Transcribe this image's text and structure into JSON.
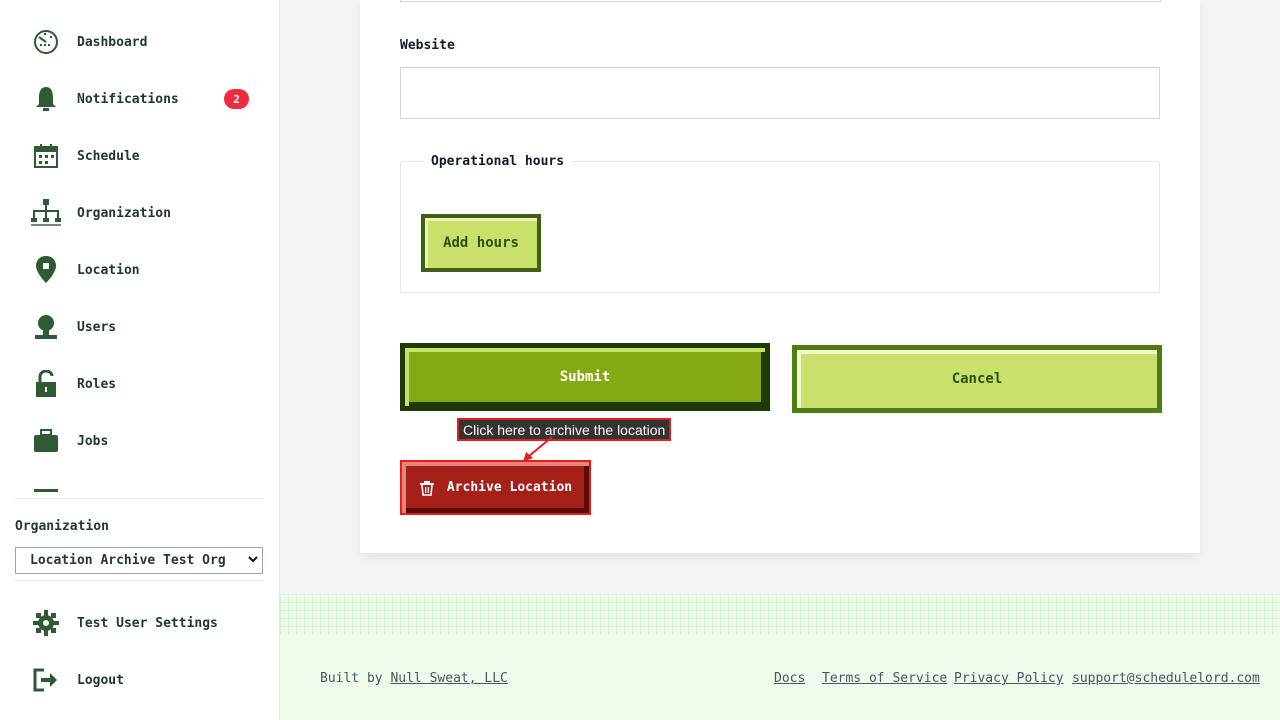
{
  "sidebar": {
    "items": [
      {
        "label": "Dashboard",
        "icon": "dashboard-icon"
      },
      {
        "label": "Notifications",
        "icon": "bell-icon",
        "badge": "2"
      },
      {
        "label": "Schedule",
        "icon": "calendar-icon"
      },
      {
        "label": "Organization",
        "icon": "org-chart-icon"
      },
      {
        "label": "Location",
        "icon": "location-pin-icon"
      },
      {
        "label": "Users",
        "icon": "user-icon"
      },
      {
        "label": "Roles",
        "icon": "lock-icon"
      },
      {
        "label": "Jobs",
        "icon": "briefcase-icon"
      }
    ],
    "organization_label": "Organization",
    "organization_selected": "Location Archive Test Org",
    "settings_label": "Test User Settings",
    "logout_label": "Logout"
  },
  "form": {
    "website_label": "Website",
    "website_value": "",
    "hours_legend": "Operational hours",
    "add_hours_label": "Add hours",
    "submit_label": "Submit",
    "cancel_label": "Cancel",
    "archive_label": "Archive Location",
    "tooltip": "Click here to archive the location"
  },
  "footer": {
    "built_by_prefix": "Built by",
    "built_by_link": "Null Sweat, LLC",
    "links": [
      "Docs",
      "Terms of Service",
      "Privacy Policy",
      "support@schedulelord.com"
    ]
  },
  "colors": {
    "primary_dark": "#1f3a2a",
    "accent_green": "#84a913",
    "light_green": "#c9e06c",
    "danger": "#a6201a",
    "badge": "#ef2b3d",
    "footer_bg": "#eefbea"
  }
}
